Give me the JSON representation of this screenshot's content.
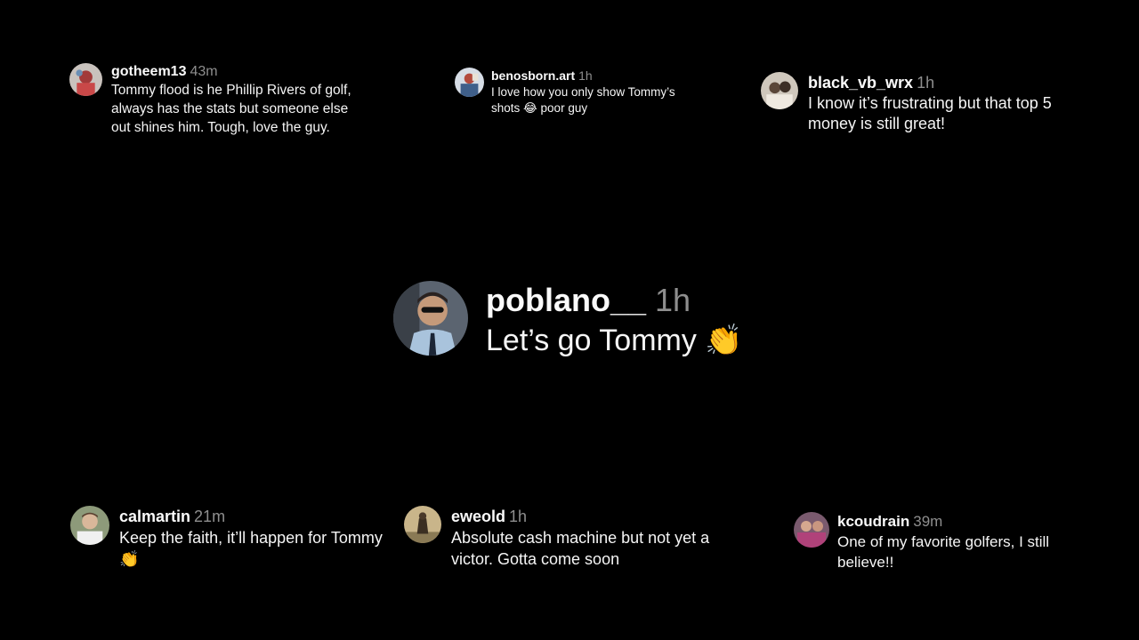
{
  "comments": [
    {
      "username": "gotheem13",
      "time": "43m",
      "text": "Tommy flood is he Phillip Rivers of golf, always has the stats but someone else out shines him. Tough, love the guy."
    },
    {
      "username": "benosborn.art",
      "time": "1h",
      "text": "I love how you only show Tommy’s shots 😂 poor guy"
    },
    {
      "username": "black_vb_wrx",
      "time": "1h",
      "text": "I know it’s frustrating but that top 5 money is still great!"
    },
    {
      "username": "poblano__",
      "time": "1h",
      "text": "Let’s go Tommy 👏"
    },
    {
      "username": "calmartin",
      "time": "21m",
      "text": "Keep the faith, it’ll happen for Tommy 👏"
    },
    {
      "username": "eweold",
      "time": "1h",
      "text": "Absolute cash machine but not yet a victor. Gotta come soon"
    },
    {
      "username": "kcoudrain",
      "time": "39m",
      "text": "One of my favorite golfers, I still believe!!"
    }
  ],
  "colors": {
    "background": "#000000",
    "username": "#fafafa",
    "timestamp": "#8e8e8e",
    "text": "#f5f5f5"
  }
}
